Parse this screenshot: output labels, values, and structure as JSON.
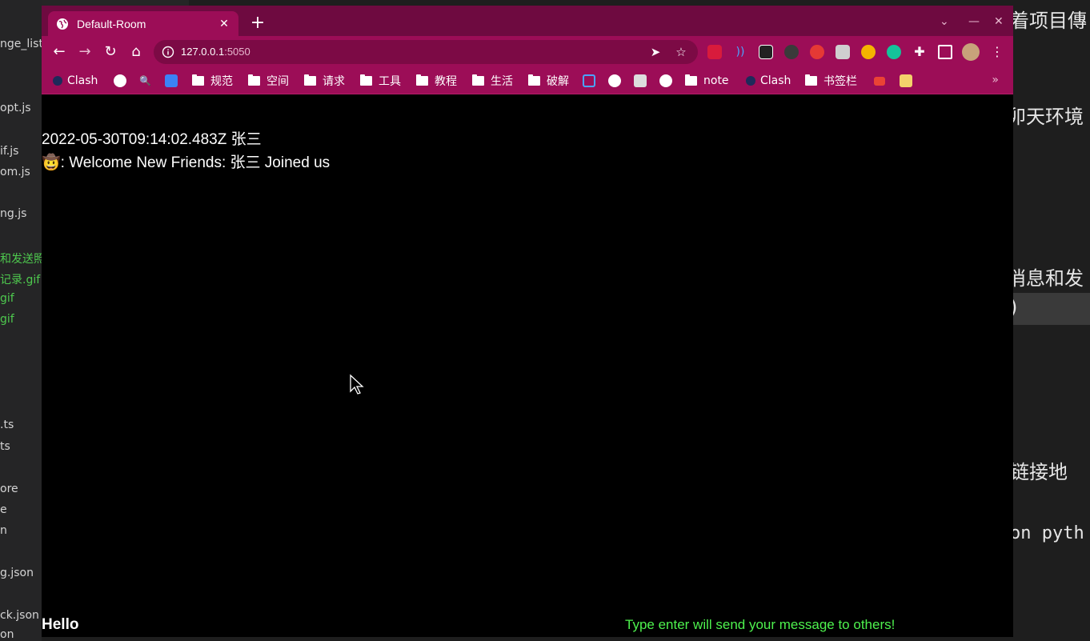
{
  "background": {
    "sidebar_files": [
      {
        "label": "nge_list",
        "color": "normal"
      },
      {
        "label": "opt.js",
        "color": "normal"
      },
      {
        "label": "if.js",
        "color": "normal"
      },
      {
        "label": "om.js",
        "color": "normal"
      },
      {
        "label": "ng.js",
        "color": "normal"
      },
      {
        "label": "和发送照",
        "color": "green"
      },
      {
        "label": "记录.gif",
        "color": "green"
      },
      {
        "label": "gif",
        "color": "green"
      },
      {
        "label": "gif",
        "color": "green"
      },
      {
        "label": ".ts",
        "color": "normal"
      },
      {
        "label": "ts",
        "color": "normal"
      },
      {
        "label": "ore",
        "color": "normal"
      },
      {
        "label": "e",
        "color": "normal"
      },
      {
        "label": "n",
        "color": "normal"
      },
      {
        "label": "g.json",
        "color": "normal"
      },
      {
        "label": "ck.json",
        "color": "normal"
      },
      {
        "label": "on",
        "color": "normal"
      }
    ],
    "right_doc": {
      "line1": "着项目傳",
      "line2": "卯天环境",
      "line3": "消息和发",
      "line4": ")",
      "line5": "链接地",
      "code_line": "on pyth"
    }
  },
  "browser": {
    "tab_title": "Default-Room",
    "url_host": "127.0.0.1",
    "url_port": ":5050",
    "bookmarks": [
      {
        "label": "Clash",
        "icon": "clash-icon"
      },
      {
        "label": "",
        "icon": "google-icon"
      },
      {
        "label": "",
        "icon": "search-icon"
      },
      {
        "label": "",
        "icon": "translate-icon"
      },
      {
        "label": "规范",
        "icon": "folder-icon"
      },
      {
        "label": "空间",
        "icon": "folder-icon"
      },
      {
        "label": "请求",
        "icon": "folder-icon"
      },
      {
        "label": "工具",
        "icon": "folder-icon"
      },
      {
        "label": "教程",
        "icon": "folder-icon"
      },
      {
        "label": "生活",
        "icon": "folder-icon"
      },
      {
        "label": "破解",
        "icon": "folder-icon"
      },
      {
        "label": "note",
        "icon": "globe-icon"
      },
      {
        "label": "Clash",
        "icon": "clash-icon"
      },
      {
        "label": "书签栏",
        "icon": "folder-icon"
      }
    ]
  },
  "chat": {
    "messages": [
      {
        "text": "2022-05-30T09:14:02.483Z 张三"
      },
      {
        "text": "🤠: Welcome New Friends: 张三 Joined us"
      }
    ],
    "input_value": "Hello",
    "hint": "Type enter will send your message to others!"
  },
  "colors": {
    "browser_accent": "#9c0d57",
    "titlebar": "#6e0a40",
    "hint_green": "#4ef24e"
  }
}
